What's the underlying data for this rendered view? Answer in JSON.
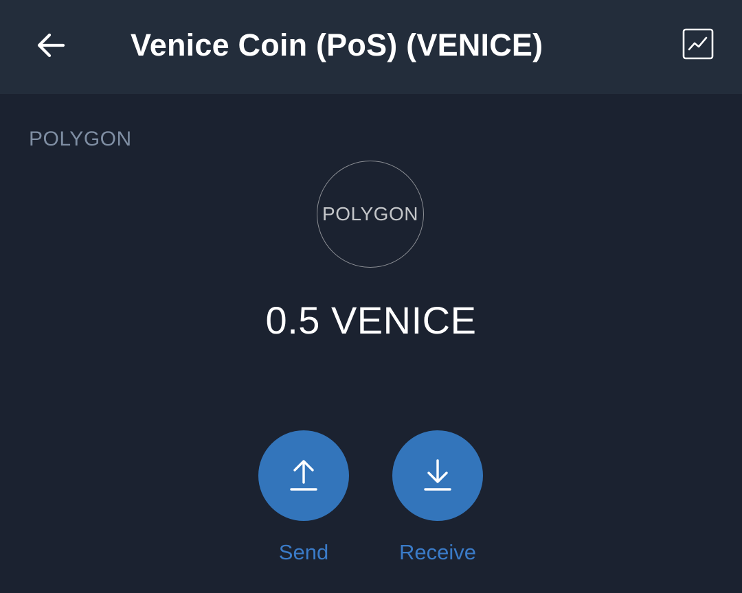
{
  "header": {
    "title": "Venice Coin (PoS) (VENICE)",
    "back_icon": "arrow-left-icon",
    "chart_icon": "chart-line-icon"
  },
  "network": {
    "label": "POLYGON"
  },
  "token": {
    "logo_text": "POLYGON",
    "balance": "0.5 VENICE"
  },
  "actions": {
    "send": {
      "label": "Send",
      "icon": "arrow-up-icon"
    },
    "receive": {
      "label": "Receive",
      "icon": "arrow-down-icon"
    }
  },
  "colors": {
    "background": "#1b2230",
    "header_background": "#232d3b",
    "accent": "#3375bb",
    "muted_text": "#7f8ea3"
  }
}
